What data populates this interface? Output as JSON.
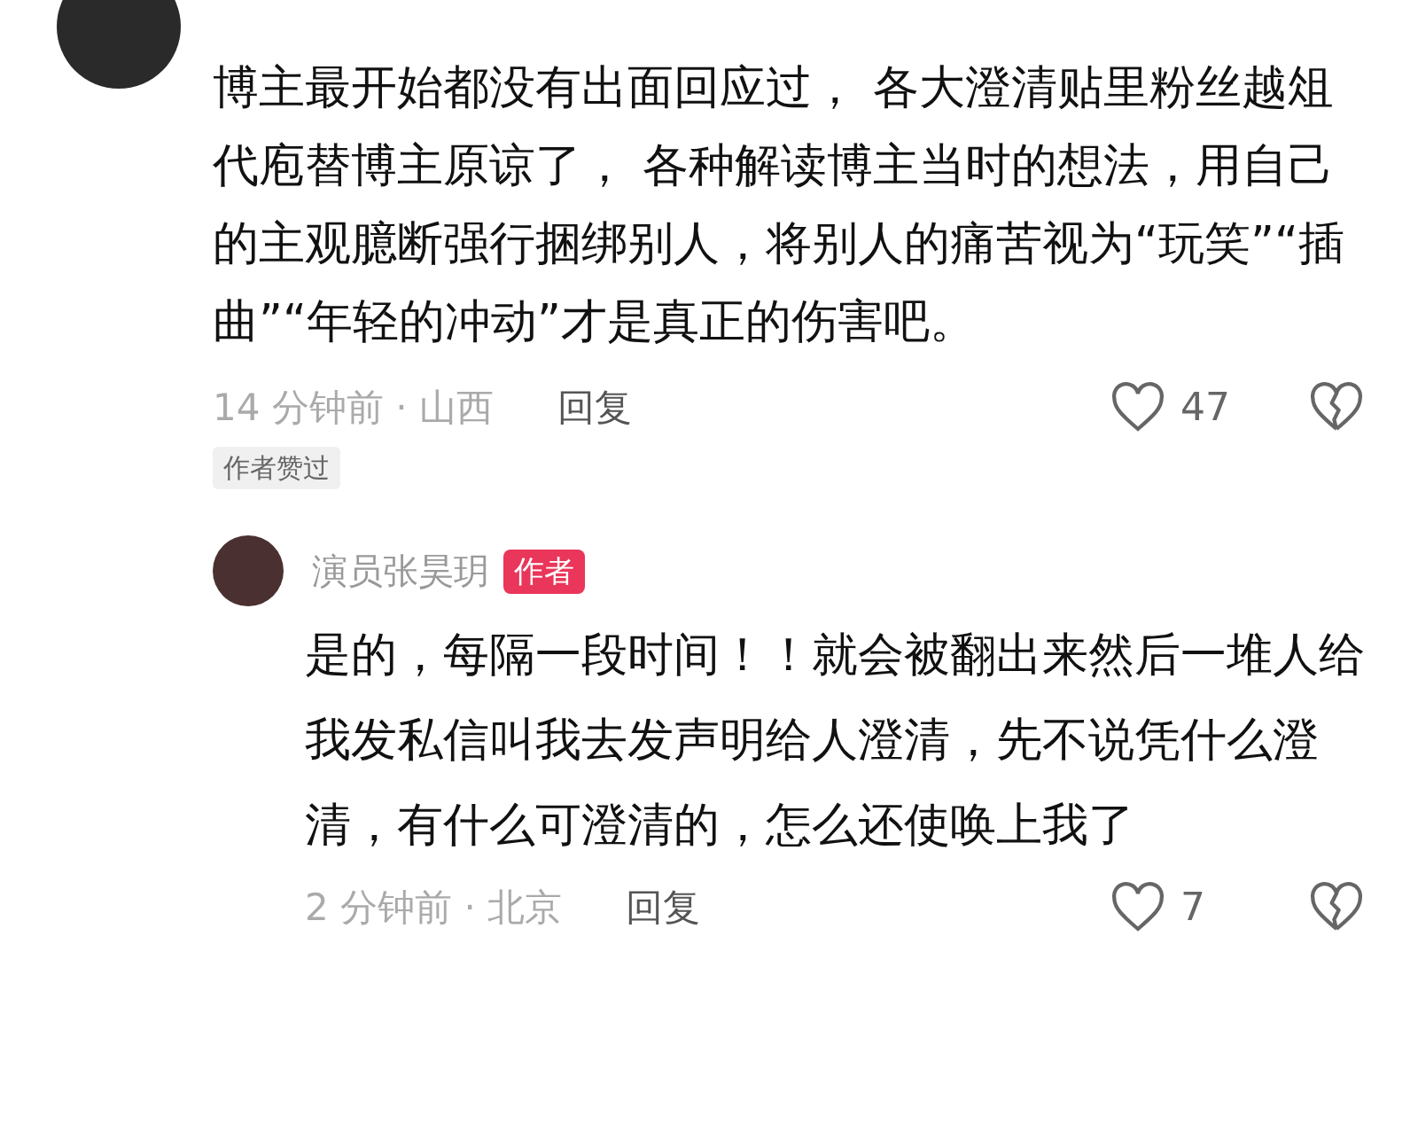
{
  "comment": {
    "text": "博主最开始都没有出面回应过， 各大澄清贴里粉丝越俎代庖替博主原谅了， 各种解读博主当时的想法，用自己的主观臆断强行捆绑别人，将别人的痛苦视为“玩笑”“插曲”“年轻的冲动”才是真正的伤害吧。",
    "time_location": "14 分钟前 · 山西",
    "reply_label": "回复",
    "likes": "47",
    "author_liked_tag": "作者赞过",
    "reply": {
      "author": "演员张昊玥",
      "author_badge": "作者",
      "text": "是的，每隔一段时间！！就会被翻出来然后一堆人给我发私信叫我去发声明给人澄清，先不说凭什么澄清，有什么可澄清的，怎么还使唤上我了",
      "time_location": "2 分钟前 · 北京",
      "reply_label": "回复",
      "likes": "7"
    }
  }
}
